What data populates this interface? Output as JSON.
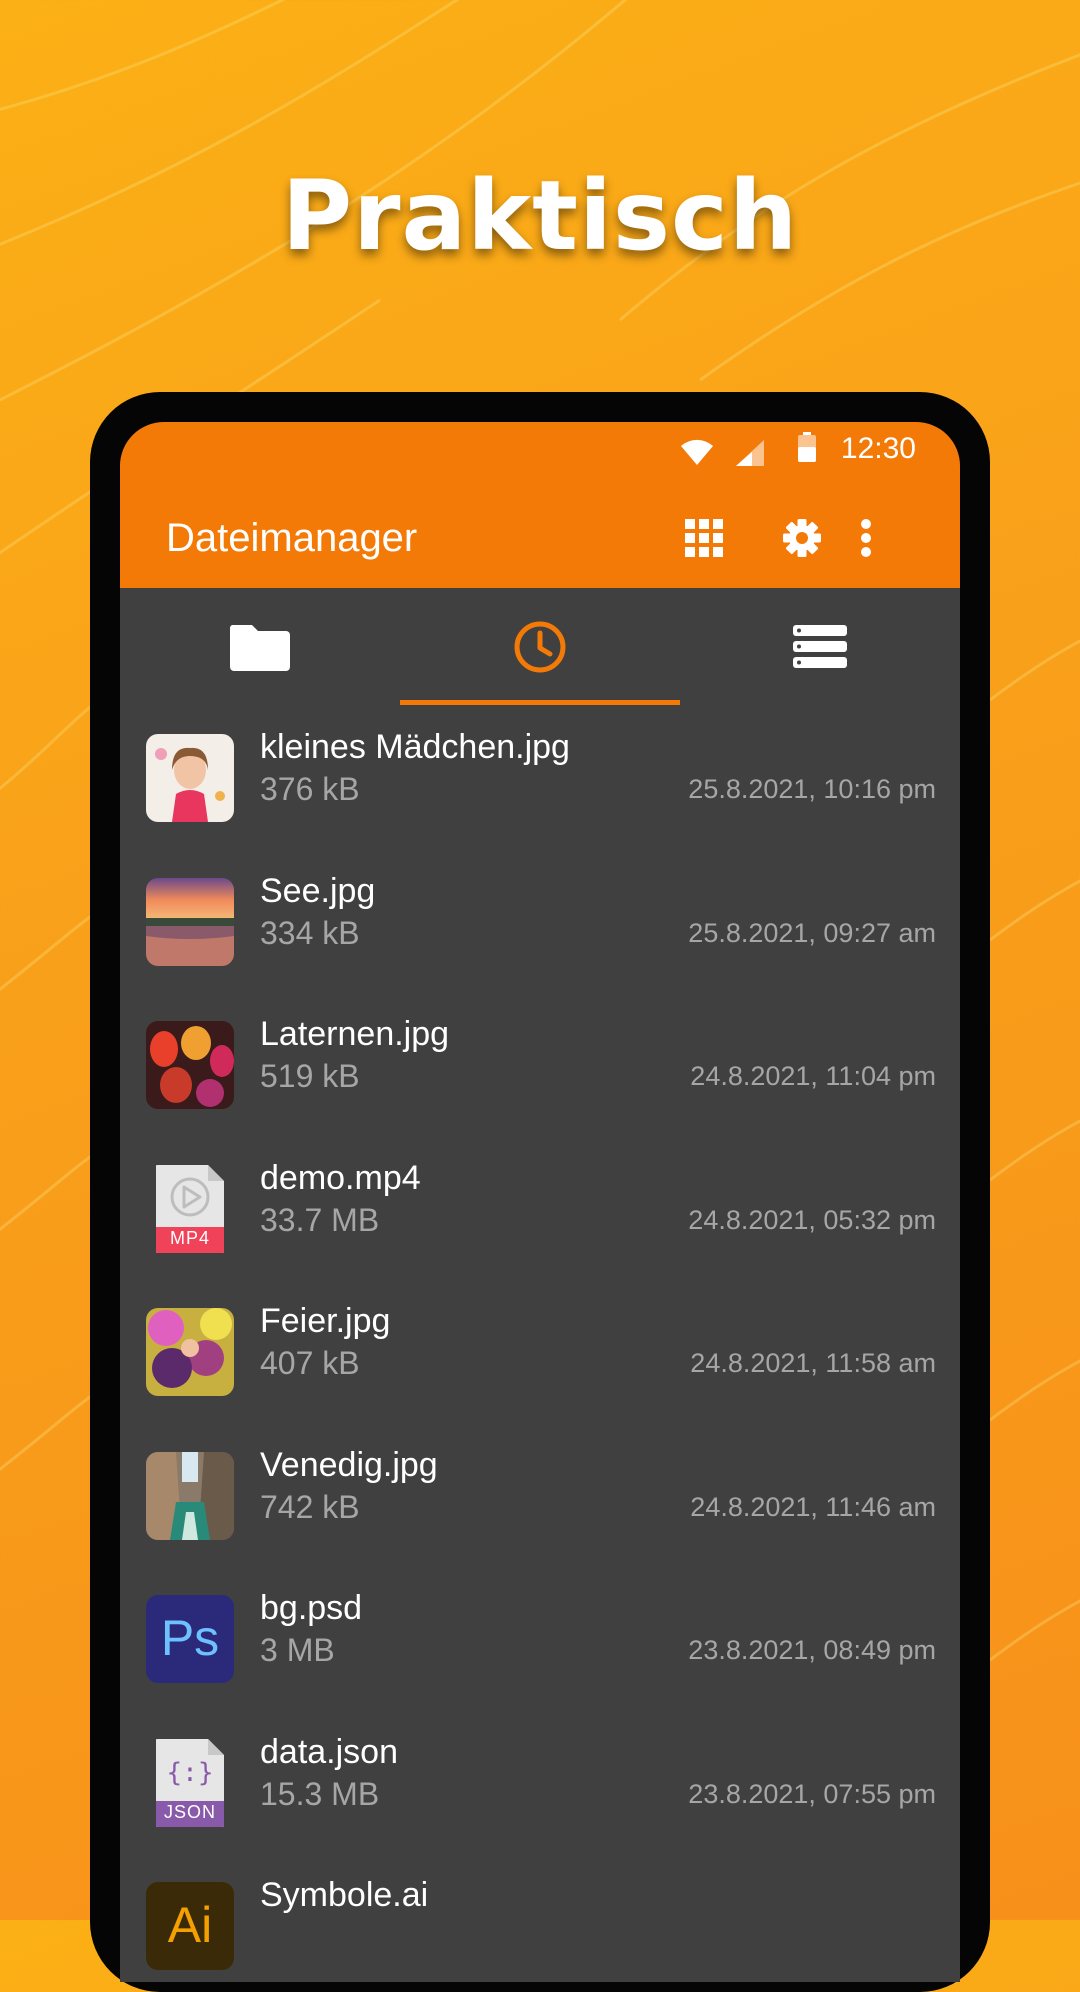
{
  "headline": "Praktisch",
  "status": {
    "time": "12:30"
  },
  "appbar": {
    "title": "Dateimanager",
    "icons": [
      "grid-view-icon",
      "settings-gear-icon",
      "more-vert-icon"
    ]
  },
  "tabs": [
    {
      "icon": "folder-icon",
      "selected": false
    },
    {
      "icon": "recent-clock-icon",
      "selected": true
    },
    {
      "icon": "storage-icon",
      "selected": false
    }
  ],
  "colors": {
    "accent": "#f47a08",
    "background": "#fba51a",
    "list_bg": "#404040",
    "secondary_text": "#a6a6a6"
  },
  "files": [
    {
      "name": "kleines Mädchen.jpg",
      "size": "376 kB",
      "date": "25.8.2021, 10:16 pm",
      "thumb": "photo-girl"
    },
    {
      "name": "See.jpg",
      "size": "334 kB",
      "date": "25.8.2021, 09:27 am",
      "thumb": "photo-lake-sunset"
    },
    {
      "name": "Laternen.jpg",
      "size": "519 kB",
      "date": "24.8.2021, 11:04 pm",
      "thumb": "photo-lanterns"
    },
    {
      "name": "demo.mp4",
      "size": "33.7 MB",
      "date": "24.8.2021, 05:32 pm",
      "thumb": "mp4-file-icon",
      "badge": "MP4"
    },
    {
      "name": "Feier.jpg",
      "size": "407 kB",
      "date": "24.8.2021, 11:58 am",
      "thumb": "photo-party"
    },
    {
      "name": "Venedig.jpg",
      "size": "742 kB",
      "date": "24.8.2021, 11:46 am",
      "thumb": "photo-venice"
    },
    {
      "name": "bg.psd",
      "size": "3 MB",
      "date": "23.8.2021, 08:49 pm",
      "thumb": "psd-file-icon",
      "badge": "Ps"
    },
    {
      "name": "data.json",
      "size": "15.3 MB",
      "date": "23.8.2021, 07:55 pm",
      "thumb": "json-file-icon",
      "badge": "JSON"
    },
    {
      "name": "Symbole.ai",
      "size": "",
      "date": "",
      "thumb": "ai-file-icon",
      "badge": "Ai"
    }
  ]
}
